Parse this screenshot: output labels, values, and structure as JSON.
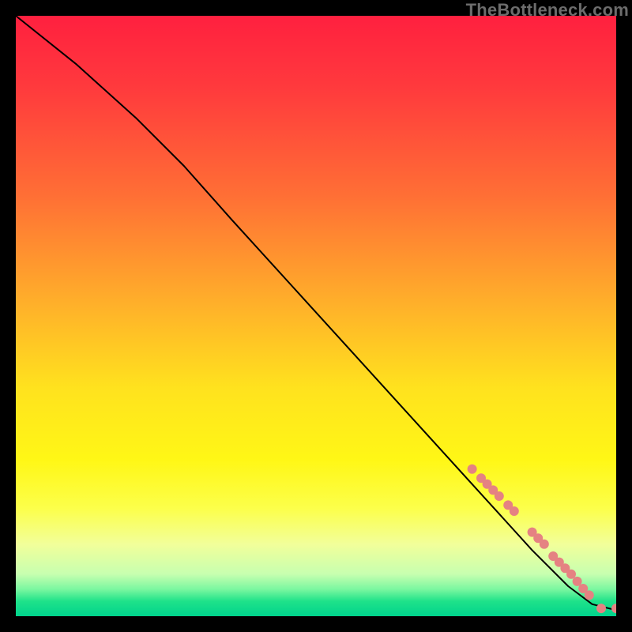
{
  "watermark": "TheBottleneck.com",
  "chart_data": {
    "type": "line",
    "title": "",
    "xlabel": "",
    "ylabel": "",
    "xlim": [
      0,
      100
    ],
    "ylim": [
      0,
      100
    ],
    "background_gradient": {
      "stops": [
        {
          "offset": 0.0,
          "color": "#ff203f"
        },
        {
          "offset": 0.12,
          "color": "#ff3a3d"
        },
        {
          "offset": 0.3,
          "color": "#ff6f35"
        },
        {
          "offset": 0.48,
          "color": "#ffb02a"
        },
        {
          "offset": 0.62,
          "color": "#ffe21e"
        },
        {
          "offset": 0.74,
          "color": "#fff716"
        },
        {
          "offset": 0.82,
          "color": "#fcff4a"
        },
        {
          "offset": 0.88,
          "color": "#f2ff9a"
        },
        {
          "offset": 0.93,
          "color": "#c7ffb0"
        },
        {
          "offset": 0.955,
          "color": "#7bf7a0"
        },
        {
          "offset": 0.975,
          "color": "#1fe28a"
        },
        {
          "offset": 1.0,
          "color": "#00d38c"
        }
      ]
    },
    "series": [
      {
        "name": "curve",
        "color": "#000000",
        "stroke_width": 2,
        "x": [
          0,
          10,
          20,
          28,
          36,
          46,
          56,
          66,
          76,
          86,
          92,
          96,
          100
        ],
        "y": [
          100,
          92,
          83,
          75,
          66,
          55,
          44,
          33,
          22,
          11,
          5,
          2,
          1
        ]
      }
    ],
    "markers": {
      "name": "highlight-points",
      "color": "#e58282",
      "radius": 6,
      "points": [
        {
          "x": 76.0,
          "y": 24.5
        },
        {
          "x": 77.5,
          "y": 23.0
        },
        {
          "x": 78.5,
          "y": 22.0
        },
        {
          "x": 79.5,
          "y": 21.0
        },
        {
          "x": 80.5,
          "y": 20.0
        },
        {
          "x": 82.0,
          "y": 18.5
        },
        {
          "x": 83.0,
          "y": 17.5
        },
        {
          "x": 86.0,
          "y": 14.0
        },
        {
          "x": 87.0,
          "y": 13.0
        },
        {
          "x": 88.0,
          "y": 12.0
        },
        {
          "x": 89.5,
          "y": 10.0
        },
        {
          "x": 90.5,
          "y": 9.0
        },
        {
          "x": 91.5,
          "y": 8.0
        },
        {
          "x": 92.5,
          "y": 7.0
        },
        {
          "x": 93.5,
          "y": 5.8
        },
        {
          "x": 94.5,
          "y": 4.6
        },
        {
          "x": 95.5,
          "y": 3.5
        },
        {
          "x": 97.5,
          "y": 1.3
        },
        {
          "x": 100.0,
          "y": 1.3
        }
      ]
    }
  }
}
